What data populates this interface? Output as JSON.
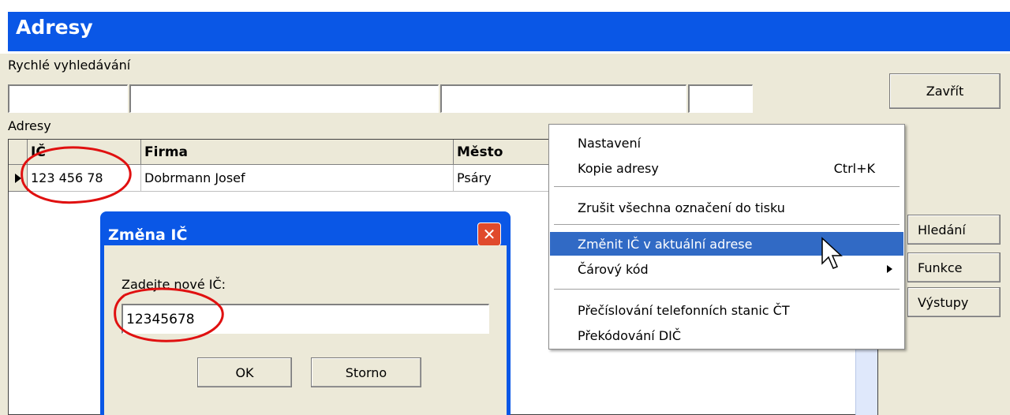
{
  "window": {
    "title": "Adresy"
  },
  "quick_search": {
    "label": "Rychlé vyhledávání",
    "fields": [
      "",
      "",
      "",
      ""
    ]
  },
  "buttons": {
    "close": "Zavřít",
    "search": "Hledání",
    "functions": "Funkce",
    "outputs": "Výstupy"
  },
  "grid": {
    "label": "Adresy",
    "columns": [
      "IČ",
      "Firma",
      "Město"
    ],
    "rows": [
      {
        "ic": "123 456 78",
        "firma": "Dobrmann Josef",
        "mesto": "Psáry"
      }
    ]
  },
  "context_menu": {
    "items": [
      {
        "label": "Nastavení",
        "shortcut": ""
      },
      {
        "label": "Kopie adresy",
        "shortcut": "Ctrl+K"
      },
      {
        "label": "Zrušit všechna označení do tisku",
        "shortcut": ""
      },
      {
        "label": "Změnit IČ v aktuální adrese",
        "shortcut": ""
      },
      {
        "label": "Čárový kód",
        "shortcut": ""
      },
      {
        "label": "Přečíslování telefonních stanic ČT",
        "shortcut": ""
      },
      {
        "label": "Překódování DIČ",
        "shortcut": ""
      }
    ],
    "highlight_color": "#316ac5"
  },
  "dialog": {
    "title": "Změna IČ",
    "prompt": "Zadejte nové IČ:",
    "value": "12345678",
    "ok": "OK",
    "cancel": "Storno"
  },
  "colors": {
    "title_bar": "#0a57e6",
    "annotation_circle": "#e01010"
  }
}
